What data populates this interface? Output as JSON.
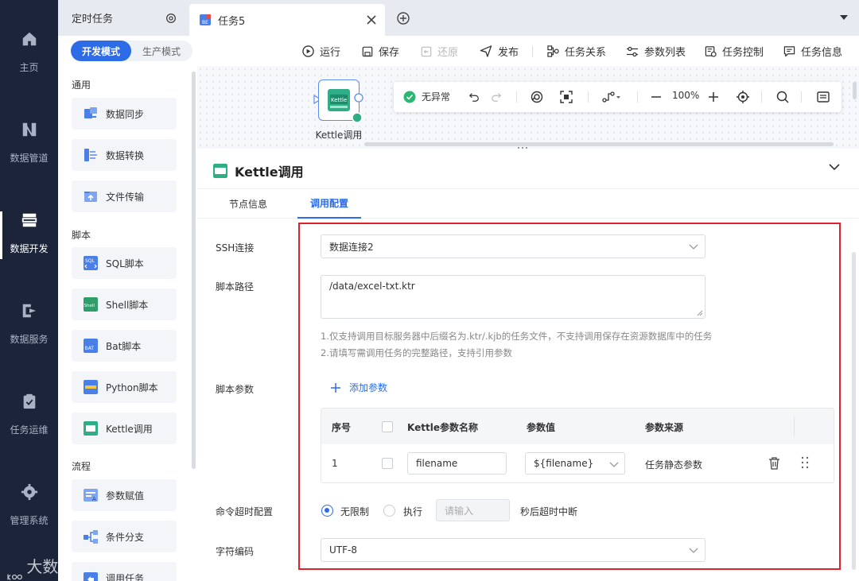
{
  "nav": {
    "items": [
      {
        "label": "主页",
        "icon": "home-icon"
      },
      {
        "label": "数据管道",
        "icon": "pipeline-icon"
      },
      {
        "label": "数据开发",
        "icon": "data-dev-icon",
        "active": true
      },
      {
        "label": "数据服务",
        "icon": "data-service-icon"
      },
      {
        "label": "任务运维",
        "icon": "task-ops-icon"
      },
      {
        "label": "管理系统",
        "icon": "gear-icon"
      }
    ],
    "watermark": "大数跨境"
  },
  "tabs": {
    "scheduled": "定时任务",
    "current": "任务5"
  },
  "mode": {
    "dev": "开发模式",
    "prod": "生产模式"
  },
  "left_panel": {
    "sections": {
      "general": "通用",
      "script": "脚本",
      "flow": "流程"
    },
    "general_items": [
      "数据同步",
      "数据转换",
      "文件传输"
    ],
    "script_items": [
      "SQL脚本",
      "Shell脚本",
      "Bat脚本",
      "Python脚本",
      "Kettle调用"
    ],
    "flow_items": [
      "参数赋值",
      "条件分支",
      "调用任务"
    ]
  },
  "toolbar": {
    "run": "运行",
    "save": "保存",
    "restore": "还原",
    "publish": "发布",
    "relations": "任务关系",
    "params": "参数列表",
    "control": "任务控制",
    "info": "任务信息"
  },
  "canvas": {
    "node_label": "Kettle调用",
    "status": "无异常",
    "zoom": "100%"
  },
  "panel": {
    "title": "Kettle调用",
    "tabs": [
      "节点信息",
      "调用配置"
    ],
    "ssh_label": "SSH连接",
    "ssh_value": "数据连接2",
    "path_label": "脚本路径",
    "path_value": "/data/excel-txt.ktr",
    "hint1": "1.仅支持调用目标服务器中后缀名为.ktr/.kjb的任务文件，不支持调用保存在资源数据库中的任务",
    "hint2": "2.请填写需调用任务的完整路径，支持引用参数",
    "param_label": "脚本参数",
    "add_param": "添加参数",
    "table": {
      "headers": [
        "序号",
        "Kettle参数名称",
        "参数值",
        "参数来源"
      ],
      "rows": [
        {
          "index": "1",
          "name": "filename",
          "value": "${filename}",
          "source": "任务静态参数"
        }
      ]
    },
    "timeout_label": "命令超时配置",
    "timeout_unlimited": "无限制",
    "timeout_exec": "执行",
    "timeout_placeholder": "请输入",
    "timeout_suffix": "秒后超时中断",
    "encoding_label": "字符编码",
    "encoding_value": "UTF-8"
  },
  "colors": {
    "primary": "#2e6be6",
    "nav_bg": "#1b2438",
    "highlight_box": "#e0202a",
    "status_ok": "#2bb673"
  }
}
